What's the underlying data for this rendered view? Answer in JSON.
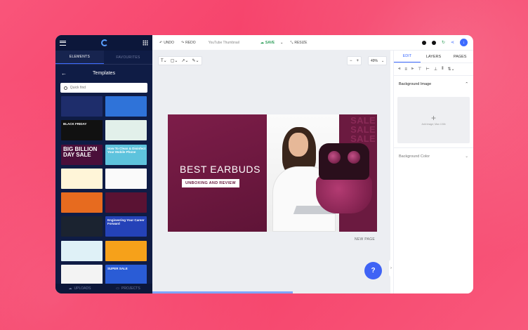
{
  "left_panel": {
    "tabs": [
      "ELEMENTS",
      "FAVOURITES"
    ],
    "header_title": "Templates",
    "search_placeholder": "Quick find",
    "bottom": [
      "UPLOADS",
      "PROJECTS"
    ],
    "thumbnails": [
      {
        "label": "",
        "bg": "#1e2d6b"
      },
      {
        "label": "",
        "bg": "#2f73d9"
      },
      {
        "label": "BLACK FRIDAY",
        "bg": "#111111"
      },
      {
        "label": "",
        "bg": "#e2f0ea"
      },
      {
        "label": "BIG BILLION DAY SALE",
        "bg": "#4a0f3a"
      },
      {
        "label": "How To Clean & Disinfect Your Mobile Phone",
        "bg": "#5ec3dd"
      },
      {
        "label": "",
        "bg": "#fff5d8"
      },
      {
        "label": "",
        "bg": "#fafafa"
      },
      {
        "label": "",
        "bg": "#e76b1f"
      },
      {
        "label": "",
        "bg": "#5a1233"
      },
      {
        "label": "",
        "bg": "#1b2330"
      },
      {
        "label": "Engineering Your Career Forward",
        "bg": "#2442b8"
      },
      {
        "label": "",
        "bg": "#dff1f7"
      },
      {
        "label": "",
        "bg": "#f6a11a"
      },
      {
        "label": "",
        "bg": "#f3f3f3"
      },
      {
        "label": "SUPER SALE",
        "bg": "#2a5cd6"
      }
    ]
  },
  "topbar": {
    "undo": "UNDO",
    "redo": "REDO",
    "doc_name": "YouTube Thumbnail",
    "save": "SAVE",
    "resize": "RESIZE"
  },
  "canvas": {
    "zoom": "49%",
    "design": {
      "headline": "BEST EARBUDS",
      "tag": "UNBOXING AND REVIEW",
      "sale_words": [
        "SALE",
        "SALE",
        "SALE"
      ]
    },
    "new_page": "NEW PAGE",
    "help": "?"
  },
  "right_panel": {
    "tabs": [
      "EDIT",
      "LAYERS",
      "PAGES"
    ],
    "bg_image_label": "Background Image",
    "upload_hint": "Add image; Max 4 Mb",
    "bg_color_label": "Background Color"
  }
}
